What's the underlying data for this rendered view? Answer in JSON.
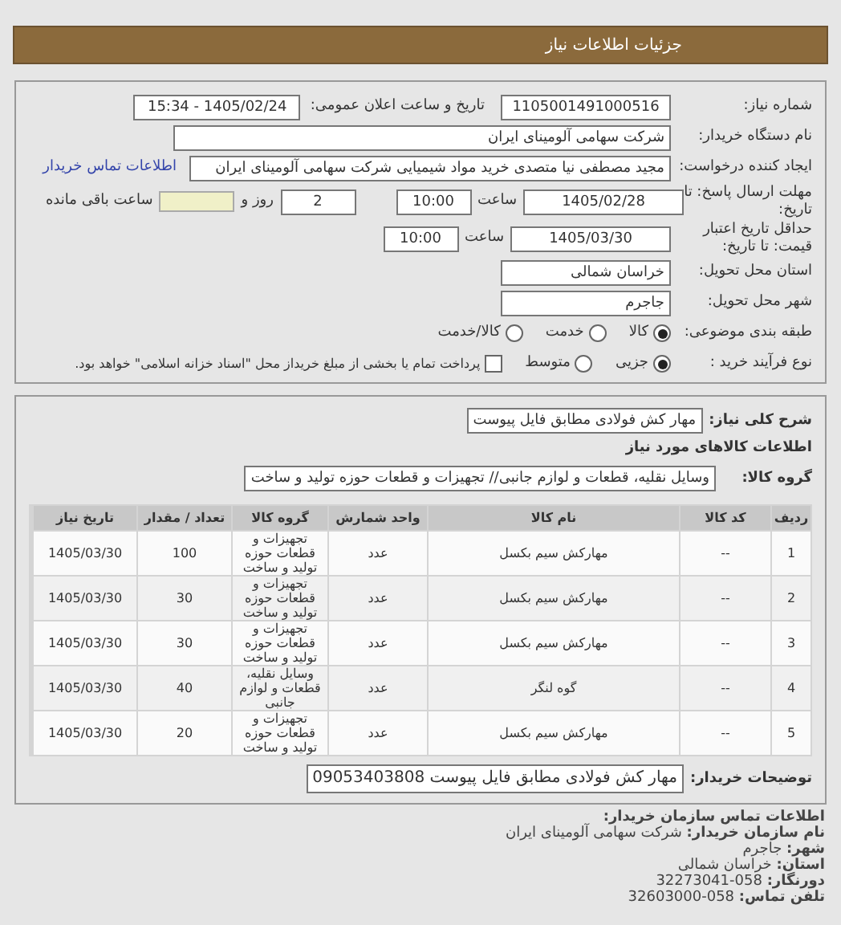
{
  "header": {
    "title": "جزئیات اطلاعات نیاز"
  },
  "need_number": {
    "label": "شماره نیاز:",
    "value": "1105001491000516"
  },
  "announce": {
    "label": "تاریخ و ساعت اعلان عمومی:",
    "value": "1405/02/24 - 15:34"
  },
  "buyer_org": {
    "label": "نام دستگاه خریدار:",
    "value": "شرکت سهامی آلومینای ایران"
  },
  "requester": {
    "label": "ایجاد کننده درخواست:",
    "value": "مجید مصطفی نیا متصدی خرید مواد شیمیایی شرکت سهامی آلومینای ایران",
    "link": "اطلاعات تماس خریدار"
  },
  "deadline": {
    "label": "مهلت ارسال پاسخ: تا تاریخ:",
    "date": "1405/02/28",
    "time_label": "ساعت",
    "time": "10:00",
    "days": "2",
    "days_label": "روز و",
    "remaining_label": "ساعت باقی مانده"
  },
  "validity": {
    "label": "حداقل تاریخ اعتبار قیمت: تا تاریخ:",
    "date": "1405/03/30",
    "time_label": "ساعت",
    "time": "10:00"
  },
  "province": {
    "label": "استان محل تحویل:",
    "value": "خراسان شمالی"
  },
  "city": {
    "label": "شهر محل تحویل:",
    "value": "جاجرم"
  },
  "category": {
    "label": "طبقه بندی موضوعی:",
    "options": [
      {
        "label": "کالا",
        "selected": true
      },
      {
        "label": "خدمت",
        "selected": false
      },
      {
        "label": "کالا/خدمت",
        "selected": false
      }
    ]
  },
  "process": {
    "label": "نوع فرآیند خرید :",
    "options": [
      {
        "label": "جزیی",
        "selected": true
      },
      {
        "label": "متوسط",
        "selected": false
      }
    ],
    "treasury": {
      "checked": false,
      "text": "پرداخت تمام یا بخشی از مبلغ خریداز محل \"اسناد خزانه اسلامی\" خواهد بود."
    }
  },
  "description": {
    "label": "شرح کلی نیاز:",
    "value": "مهار کش فولادی مطابق فایل پیوست"
  },
  "goods_title": "اطلاعات کالاهای مورد نیاز",
  "goods_group": {
    "label": "گروه کالا:",
    "value": "وسایل نقلیه، قطعات و لوازم جانبی// تجهیزات و قطعات حوزه تولید و ساخت"
  },
  "table": {
    "columns": [
      "ردیف",
      "کد کالا",
      "نام کالا",
      "واحد شمارش",
      "گروه کالا",
      "تعداد / مقدار",
      "تاریخ نیاز"
    ],
    "rows": [
      [
        "1",
        "--",
        "مهارکش سیم بکسل",
        "عدد",
        "تجهیزات و قطعات حوزه تولید و ساخت",
        "100",
        "1405/03/30"
      ],
      [
        "2",
        "--",
        "مهارکش سیم بکسل",
        "عدد",
        "تجهیزات و قطعات حوزه تولید و ساخت",
        "30",
        "1405/03/30"
      ],
      [
        "3",
        "--",
        "مهارکش سیم بکسل",
        "عدد",
        "تجهیزات و قطعات حوزه تولید و ساخت",
        "30",
        "1405/03/30"
      ],
      [
        "4",
        "--",
        "گوه لنگر",
        "عدد",
        "وسایل نقلیه، قطعات و لوازم جانبی",
        "40",
        "1405/03/30"
      ],
      [
        "5",
        "--",
        "مهارکش سیم بکسل",
        "عدد",
        "تجهیزات و قطعات حوزه تولید و ساخت",
        "20",
        "1405/03/30"
      ]
    ]
  },
  "buyer_notes": {
    "label": "توضیحات خریدار:",
    "value": "مهار کش فولادی مطابق فایل پیوست 09053403808"
  },
  "contact": {
    "title": "اطلاعات تماس سازمان خریدار:",
    "lines": [
      "**نام سازمان خریدار:** شرکت سهامی آلومینای ایران",
      "**شهر:** جاجرم",
      "**استان:** خراسان شمالی",
      "**دورنگار:** 058-32273041",
      "**تلفن تماس:** 058-32603000"
    ]
  }
}
